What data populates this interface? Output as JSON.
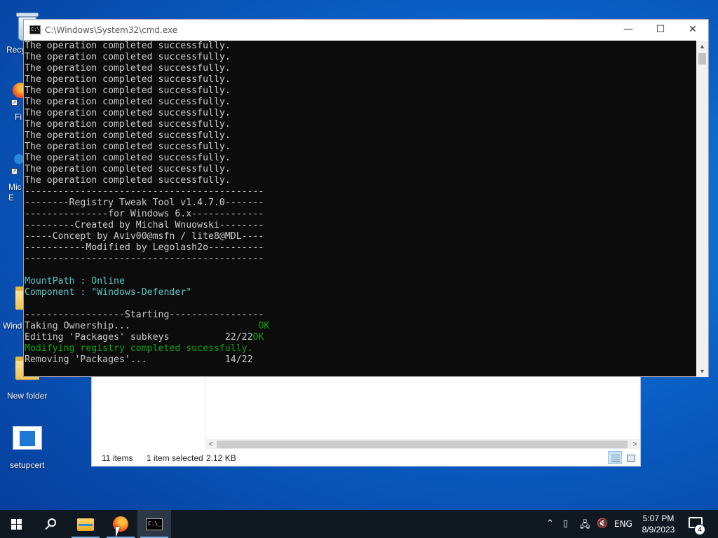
{
  "desktop": {
    "icons": [
      {
        "label": "Recy"
      },
      {
        "label": "Fi"
      },
      {
        "label": "Mic\nE"
      },
      {
        "label": "Wind"
      },
      {
        "label": "New folder"
      },
      {
        "label": "setupcert"
      }
    ]
  },
  "explorer": {
    "status_items": "11 items",
    "status_selected": "1 item selected",
    "status_size": "2.12 KB"
  },
  "cmd": {
    "title": "C:\\Windows\\System32\\cmd.exe",
    "minimize": "—",
    "maximize": "☐",
    "close": "✕",
    "lines": [
      "The operation completed successfully.",
      "The operation completed successfully.",
      "The operation completed successfully.",
      "The operation completed successfully.",
      "The operation completed successfully.",
      "The operation completed successfully.",
      "The operation completed successfully.",
      "The operation completed successfully.",
      "The operation completed successfully.",
      "The operation completed successfully.",
      "The operation completed successfully.",
      "The operation completed successfully.",
      "The operation completed successfully.",
      "-------------------------------------------",
      "--------Registry Tweak Tool v1.4.7.0-------",
      "---------------for Windows 6.x-------------",
      "---------Created by Michal Wnuowski--------",
      "-----Concept by Aviv00@msfn / lite8@MDL----",
      "-----------Modified by Legolash2o----------",
      "-------------------------------------------",
      "",
      "MountPath : Online",
      "Component : \"Windows-Defender\"",
      "",
      "------------------Starting-----------------"
    ],
    "mount_label": "MountPath : ",
    "mount_value": "Online",
    "component_label": "Component : ",
    "component_value": "\"Windows-Defender\"",
    "step1_text": "Taking Ownership...                       ",
    "step1_status": "OK",
    "step2_text": "Editing 'Packages' subkeys          22/22",
    "step2_status": "OK",
    "step3_text": "Modifying registry completed sucessfully.",
    "step4_text": "Removing 'Packages'...              14/22"
  },
  "taskbar": {
    "time": "5:07 PM",
    "date": "8/9/2023",
    "language": "ENG",
    "notification_count": "4",
    "cmd_icon_text": "C:\\_"
  },
  "colors": {
    "console_text": "#cccccc",
    "console_cyan": "#5ec4c6",
    "console_green": "#13a10e",
    "desktop_blue": "#0a5fc4"
  }
}
